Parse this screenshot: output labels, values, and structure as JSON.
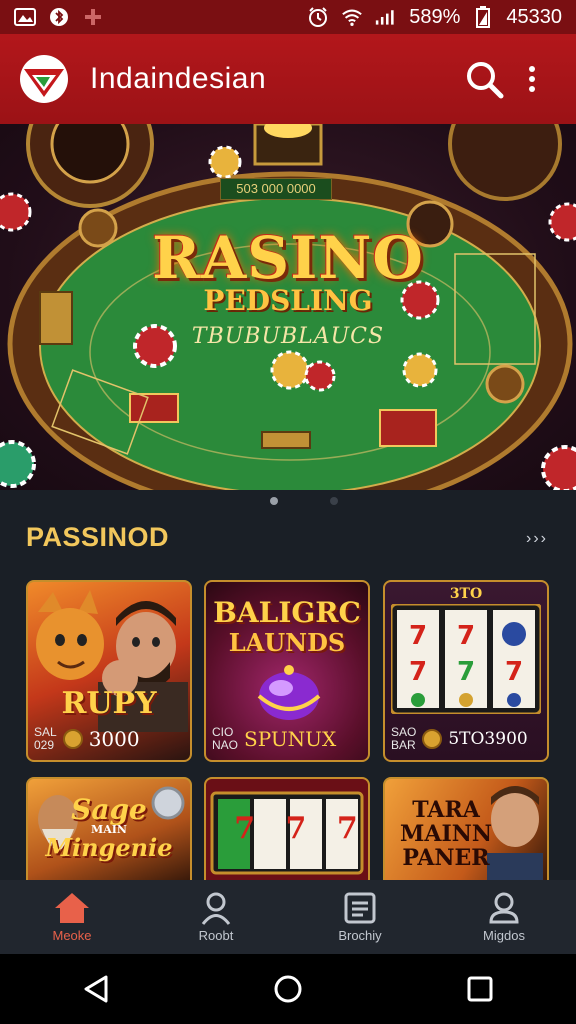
{
  "status_bar": {
    "battery": "589%",
    "time": "45330"
  },
  "app": {
    "title": "Indaindesian"
  },
  "hero": {
    "title": "RASINO",
    "subtitle": "PEDSLING",
    "tagline": "TBUBUBLAUCS",
    "table_label": "503 000 0000"
  },
  "section": {
    "title": "PASSINOD",
    "more_label": "›››"
  },
  "cards": [
    {
      "title": "RUPY",
      "small_top": "SAL",
      "small_bottom": "029",
      "value": "3000"
    },
    {
      "title_line1": "BALIGRC",
      "title_line2": "LAUNDS",
      "small_top": "CIO",
      "small_bottom": "NAO",
      "value": "SPUNUX"
    },
    {
      "title": "3TO",
      "small_top": "SAO",
      "small_bottom": "BAR",
      "value": "5TO3900"
    },
    {
      "title_line1": "Sage",
      "title_line2": "MAIN",
      "title_line3": "Mingenie"
    },
    {
      "title": "7 7 7"
    },
    {
      "title_line1": "TARA",
      "title_line2": "MAINN",
      "title_line3": "PANER"
    }
  ],
  "bottom_nav": [
    {
      "label": "Meoke",
      "icon": "home-icon",
      "active": true
    },
    {
      "label": "Roobt",
      "icon": "profile-icon",
      "active": false
    },
    {
      "label": "Brochiy",
      "icon": "history-icon",
      "active": false
    },
    {
      "label": "Migdos",
      "icon": "account-icon",
      "active": false
    }
  ],
  "colors": {
    "status_bar": "#7a0f12",
    "app_bar": "#b3171b",
    "background": "#1a1f26",
    "accent_gold": "#f2c75c",
    "nav_active": "#e8614a",
    "table_green": "#1f7a2e"
  }
}
